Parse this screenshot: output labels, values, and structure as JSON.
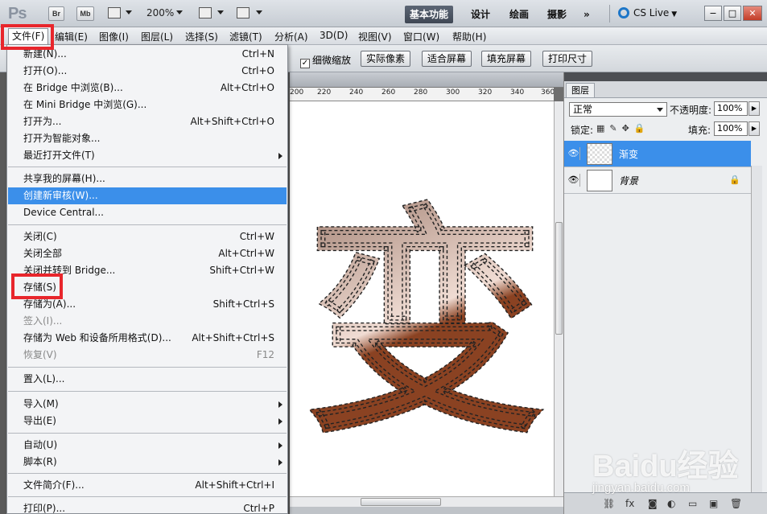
{
  "app": {
    "logo": "Ps",
    "bridge_btn": "Br",
    "minibridge_btn": "Mb",
    "zoom": "200%",
    "workspaces": [
      "基本功能",
      "设计",
      "绘画",
      "摄影"
    ],
    "more": "»",
    "cs_live": "CS Live"
  },
  "menubar": {
    "items": [
      "文件(F)",
      "编辑(E)",
      "图像(I)",
      "图层(L)",
      "选择(S)",
      "滤镜(T)",
      "分析(A)",
      "3D(D)",
      "视图(V)",
      "窗口(W)",
      "帮助(H)"
    ]
  },
  "options": {
    "fine_zoom": "细微缩放",
    "buttons": [
      "实际像素",
      "适合屏幕",
      "填充屏幕",
      "打印尺寸"
    ]
  },
  "ruler": {
    "labels": [
      "200",
      "220",
      "240",
      "260",
      "280",
      "300",
      "320",
      "340",
      "360"
    ]
  },
  "canvas": {
    "glyph": "变"
  },
  "file_menu": [
    {
      "label": "新建(N)...",
      "shortcut": "Ctrl+N"
    },
    {
      "label": "打开(O)...",
      "shortcut": "Ctrl+O"
    },
    {
      "label": "在 Bridge 中浏览(B)...",
      "shortcut": "Alt+Ctrl+O"
    },
    {
      "label": "在 Mini Bridge 中浏览(G)...",
      "shortcut": ""
    },
    {
      "label": "打开为...",
      "shortcut": "Alt+Shift+Ctrl+O"
    },
    {
      "label": "打开为智能对象...",
      "shortcut": ""
    },
    {
      "label": "最近打开文件(T)",
      "shortcut": "",
      "submenu": true
    },
    {
      "label": "共享我的屏幕(H)...",
      "shortcut": ""
    },
    {
      "label": "创建新审核(W)...",
      "shortcut": "",
      "highlighted": true
    },
    {
      "label": "Device Central...",
      "shortcut": ""
    },
    {
      "label": "关闭(C)",
      "shortcut": "Ctrl+W"
    },
    {
      "label": "关闭全部",
      "shortcut": "Alt+Ctrl+W"
    },
    {
      "label": "关闭并转到 Bridge...",
      "shortcut": "Shift+Ctrl+W"
    },
    {
      "label": "存储(S)",
      "shortcut": ""
    },
    {
      "label": "存储为(A)...",
      "shortcut": "Shift+Ctrl+S"
    },
    {
      "label": "签入(I)...",
      "shortcut": "",
      "disabled": true
    },
    {
      "label": "存储为 Web 和设备所用格式(D)...",
      "shortcut": "Alt+Shift+Ctrl+S"
    },
    {
      "label": "恢复(V)",
      "shortcut": "F12",
      "disabled": true
    },
    {
      "label": "置入(L)...",
      "shortcut": ""
    },
    {
      "label": "导入(M)",
      "shortcut": "",
      "submenu": true
    },
    {
      "label": "导出(E)",
      "shortcut": "",
      "submenu": true
    },
    {
      "label": "自动(U)",
      "shortcut": "",
      "submenu": true
    },
    {
      "label": "脚本(R)",
      "shortcut": "",
      "submenu": true
    },
    {
      "label": "文件简介(F)...",
      "shortcut": "Alt+Shift+Ctrl+I"
    },
    {
      "label": "打印(P)...",
      "shortcut": "Ctrl+P"
    }
  ],
  "layers_panel": {
    "tab": "图层",
    "blend_mode": "正常",
    "opacity_label": "不透明度:",
    "opacity": "100%",
    "lock_label": "锁定:",
    "fill_label": "填充:",
    "fill": "100%",
    "layers": [
      {
        "name": "渐变",
        "selected": true
      },
      {
        "name": "背景",
        "selected": false
      }
    ]
  },
  "watermark": {
    "brand": "Baidu经验",
    "url": "jingyan.baidu.com"
  },
  "colors": {
    "highlight": "#3b8fea",
    "annotation": "#e8262c",
    "glyph_light": "#f0dcd3",
    "glyph_dark": "#8a4222"
  }
}
